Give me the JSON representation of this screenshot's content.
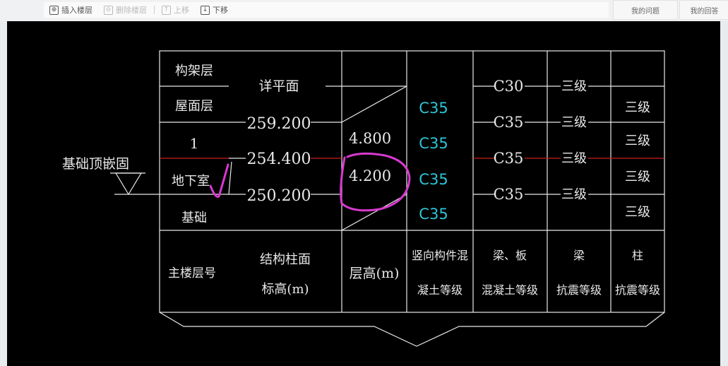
{
  "toolbar": {
    "insert_floor": "插入楼层",
    "delete_floor": "删除楼层",
    "move_up": "上移",
    "move_down": "下移"
  },
  "right_buttons": {
    "my_questions": "我的问题",
    "my_answers": "我的回答"
  },
  "drawing": {
    "foundation_top_label": "基础顶嵌固",
    "floors": [
      "构架层",
      "屋面层",
      "1",
      "地下室",
      "基础"
    ],
    "elevations": [
      "详平面",
      "259.200",
      "254.400",
      "250.200"
    ],
    "floor_heights": [
      "4.800",
      "4.200"
    ],
    "vertical_concrete": [
      "C35",
      "C35",
      "C35",
      "C35"
    ],
    "beam_slab_concrete": [
      "C30",
      "C35",
      "C35",
      "C35"
    ],
    "beam_seismic": [
      "三级",
      "三级",
      "三级",
      "三级"
    ],
    "column_seismic": [
      "三级",
      "三级",
      "三级",
      "三级"
    ],
    "headers": {
      "floor_no": "主楼层号",
      "elevation_1": "结构柱面",
      "elevation_2": "标高(m)",
      "height": "层高(m)",
      "vertical_1": "竖向构件混",
      "vertical_2": "凝土等级",
      "beam_slab_1": "梁、板",
      "beam_slab_2": "混凝土等级",
      "beam_1": "梁",
      "beam_2": "抗震等级",
      "column_1": "柱",
      "column_2": "抗震等级"
    },
    "colors": {
      "background": "#000000",
      "lines": "#e8e8e8",
      "cyan_text": "#2ec4d6",
      "red_line": "#c8201e",
      "markup": "#d83ad0"
    }
  }
}
